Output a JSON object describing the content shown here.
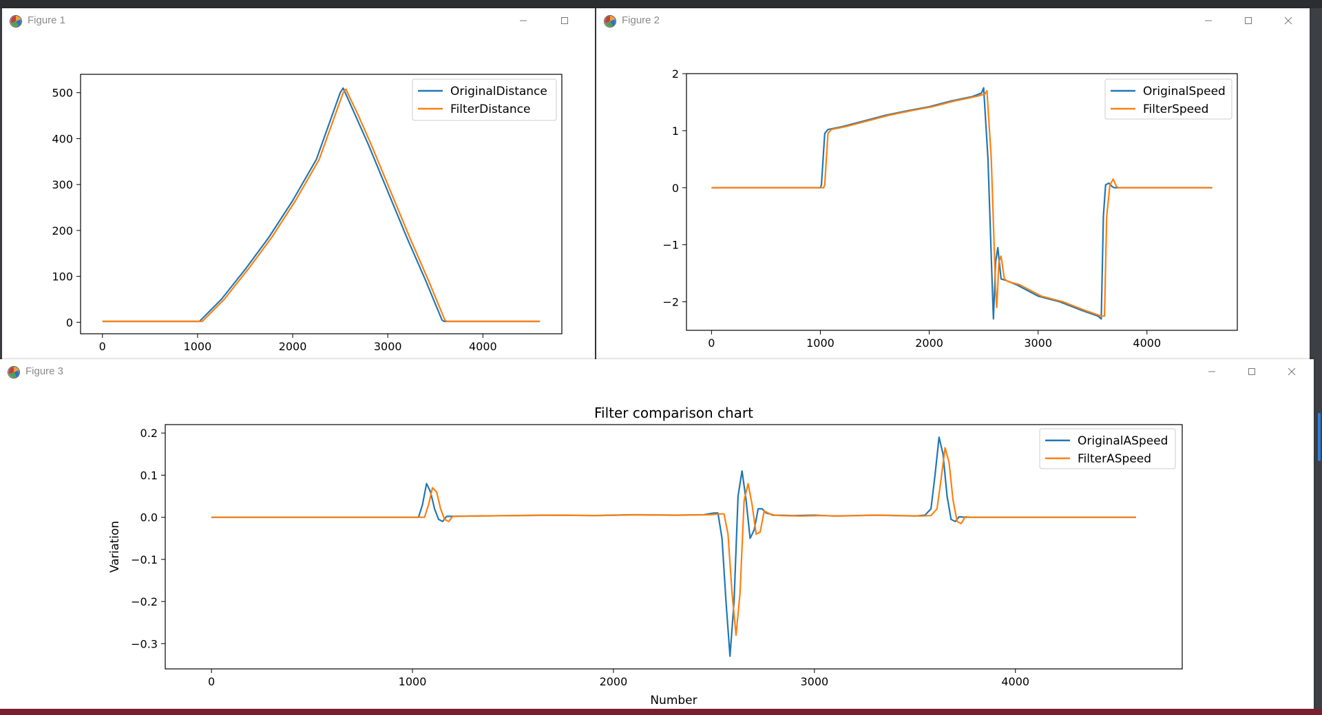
{
  "windows": [
    {
      "title": "Figure 1",
      "controls": [
        "minimize-icon",
        "maximize-icon"
      ]
    },
    {
      "title": "Figure 2",
      "controls": [
        "minimize-icon",
        "maximize-icon",
        "close-icon"
      ]
    },
    {
      "title": "Figure 3",
      "controls": [
        "minimize-icon",
        "maximize-icon",
        "close-icon"
      ]
    }
  ],
  "colors": {
    "series1": "#1f77b4",
    "series2": "#ff7f0e",
    "axes": "#000000",
    "window_title": "#8a8a8a"
  },
  "chart_data": [
    {
      "type": "line",
      "title": "",
      "xlabel": "",
      "ylabel": "",
      "xlim": [
        -230,
        4830
      ],
      "ylim": [
        -25,
        540
      ],
      "xticks": [
        0,
        1000,
        2000,
        3000,
        4000
      ],
      "yticks": [
        0,
        100,
        200,
        300,
        400,
        500
      ],
      "xtick_labels": [
        "0",
        "1000",
        "2000",
        "3000",
        "4000"
      ],
      "ytick_labels": [
        "0",
        "100",
        "200",
        "300",
        "400",
        "500"
      ],
      "grid": false,
      "legend": "top-right",
      "series": [
        {
          "name": "OriginalDistance",
          "color": "#1f77b4",
          "x": [
            0,
            1000,
            1020,
            1250,
            1500,
            1750,
            2000,
            2250,
            2500,
            2530,
            2570,
            2650,
            2800,
            3000,
            3200,
            3400,
            3570,
            3590,
            4600
          ],
          "y": [
            2,
            2,
            2,
            50,
            115,
            185,
            265,
            355,
            500,
            510,
            492,
            455,
            385,
            285,
            185,
            90,
            5,
            2,
            2
          ]
        },
        {
          "name": "FilterDistance",
          "color": "#ff7f0e",
          "x": [
            0,
            1020,
            1050,
            1280,
            1530,
            1780,
            2030,
            2280,
            2530,
            2560,
            2600,
            2680,
            2830,
            3030,
            3230,
            3430,
            3600,
            3620,
            4600
          ],
          "y": [
            2,
            2,
            2,
            50,
            115,
            185,
            265,
            355,
            500,
            508,
            490,
            455,
            385,
            285,
            185,
            90,
            5,
            2,
            2
          ]
        }
      ]
    },
    {
      "type": "line",
      "title": "",
      "xlabel": "",
      "ylabel": "",
      "xlim": [
        -230,
        4830
      ],
      "ylim": [
        -2.5,
        2.0
      ],
      "xticks": [
        0,
        1000,
        2000,
        3000,
        4000
      ],
      "yticks": [
        -2,
        -1,
        0,
        1,
        2
      ],
      "xtick_labels": [
        "0",
        "1000",
        "2000",
        "3000",
        "4000"
      ],
      "ytick_labels": [
        "−2",
        "−1",
        "0",
        "1",
        "2"
      ],
      "grid": false,
      "legend": "top-right",
      "series": [
        {
          "name": "OriginalSpeed",
          "color": "#1f77b4",
          "x": [
            0,
            1000,
            1010,
            1040,
            1070,
            1200,
            1400,
            1600,
            1800,
            2000,
            2200,
            2400,
            2480,
            2500,
            2540,
            2580,
            2590,
            2610,
            2630,
            2660,
            2700,
            2800,
            3000,
            3200,
            3400,
            3550,
            3580,
            3600,
            3620,
            3650,
            3680,
            3700,
            4600
          ],
          "y": [
            0,
            0,
            0.05,
            0.95,
            1.02,
            1.07,
            1.17,
            1.27,
            1.35,
            1.42,
            1.52,
            1.6,
            1.66,
            1.75,
            0.5,
            -1.8,
            -2.3,
            -1.3,
            -1.05,
            -1.6,
            -1.62,
            -1.7,
            -1.9,
            -2.0,
            -2.15,
            -2.25,
            -2.3,
            -0.5,
            0.05,
            0.08,
            0.02,
            0,
            0
          ]
        },
        {
          "name": "FilterSpeed",
          "color": "#ff7f0e",
          "x": [
            0,
            1030,
            1040,
            1070,
            1100,
            1230,
            1430,
            1630,
            1830,
            2030,
            2230,
            2430,
            2510,
            2530,
            2570,
            2610,
            2620,
            2640,
            2660,
            2690,
            2730,
            2830,
            3030,
            3230,
            3430,
            3580,
            3610,
            3630,
            3660,
            3690,
            3720,
            3740,
            4600
          ],
          "y": [
            0,
            0,
            0.05,
            0.95,
            1.02,
            1.07,
            1.17,
            1.27,
            1.35,
            1.42,
            1.52,
            1.6,
            1.64,
            1.7,
            0.5,
            -1.8,
            -2.1,
            -1.3,
            -1.2,
            -1.6,
            -1.65,
            -1.7,
            -1.9,
            -2.0,
            -2.15,
            -2.25,
            -2.25,
            -0.5,
            0.05,
            0.15,
            0.02,
            0,
            0
          ]
        }
      ]
    },
    {
      "type": "line",
      "title": "Filter comparison chart",
      "xlabel": "Number",
      "ylabel": "Variation",
      "xlim": [
        -230,
        4830
      ],
      "ylim": [
        -0.36,
        0.22
      ],
      "xticks": [
        0,
        1000,
        2000,
        3000,
        4000
      ],
      "yticks": [
        -0.3,
        -0.2,
        -0.1,
        0.0,
        0.1,
        0.2
      ],
      "xtick_labels": [
        "0",
        "1000",
        "2000",
        "3000",
        "4000"
      ],
      "ytick_labels": [
        "−0.3",
        "−0.2",
        "−0.1",
        "0.0",
        "0.1",
        "0.2"
      ],
      "grid": false,
      "legend": "top-right",
      "series": [
        {
          "name": "OriginalASpeed",
          "color": "#1f77b4",
          "x": [
            0,
            1030,
            1050,
            1070,
            1090,
            1110,
            1130,
            1150,
            1170,
            1300,
            1500,
            1700,
            1900,
            2100,
            2300,
            2450,
            2500,
            2520,
            2540,
            2560,
            2580,
            2600,
            2620,
            2640,
            2660,
            2680,
            2700,
            2720,
            2740,
            2760,
            2800,
            2900,
            3000,
            3100,
            3200,
            3300,
            3400,
            3500,
            3550,
            3580,
            3600,
            3620,
            3640,
            3660,
            3680,
            3700,
            3720,
            3750,
            4600
          ],
          "y": [
            0,
            0,
            0.03,
            0.08,
            0.06,
            0.02,
            -0.005,
            -0.01,
            0.002,
            0.003,
            0.004,
            0.005,
            0.004,
            0.006,
            0.005,
            0.006,
            0.01,
            0.01,
            -0.05,
            -0.2,
            -0.33,
            -0.2,
            0.05,
            0.11,
            0.04,
            -0.05,
            -0.03,
            0.02,
            0.02,
            0.01,
            0.005,
            0.004,
            0.005,
            0.003,
            0.004,
            0.005,
            0.004,
            0.003,
            0.005,
            0.02,
            0.1,
            0.19,
            0.15,
            0.05,
            -0.005,
            -0.01,
            0.001,
            0,
            0
          ]
        },
        {
          "name": "FilterASpeed",
          "color": "#ff7f0e",
          "x": [
            0,
            1060,
            1080,
            1100,
            1120,
            1140,
            1160,
            1180,
            1200,
            1330,
            1530,
            1730,
            1930,
            2130,
            2330,
            2480,
            2530,
            2550,
            2570,
            2590,
            2610,
            2630,
            2650,
            2670,
            2690,
            2710,
            2730,
            2750,
            2770,
            2790,
            2830,
            2930,
            3030,
            3130,
            3230,
            3330,
            3430,
            3530,
            3580,
            3610,
            3630,
            3650,
            3670,
            3690,
            3710,
            3730,
            3750,
            3780,
            4600
          ],
          "y": [
            0,
            0,
            0.03,
            0.07,
            0.06,
            0.02,
            -0.005,
            -0.01,
            0.002,
            0.003,
            0.004,
            0.005,
            0.004,
            0.006,
            0.005,
            0.006,
            0.008,
            0.008,
            -0.04,
            -0.18,
            -0.28,
            -0.18,
            0.04,
            0.08,
            0.03,
            -0.04,
            -0.035,
            0.015,
            0.01,
            0.005,
            0.004,
            0.003,
            0.004,
            0.003,
            0.004,
            0.005,
            0.004,
            0.003,
            0.004,
            0.02,
            0.09,
            0.165,
            0.13,
            0.04,
            -0.01,
            -0.015,
            0.001,
            0,
            0
          ]
        }
      ]
    }
  ]
}
